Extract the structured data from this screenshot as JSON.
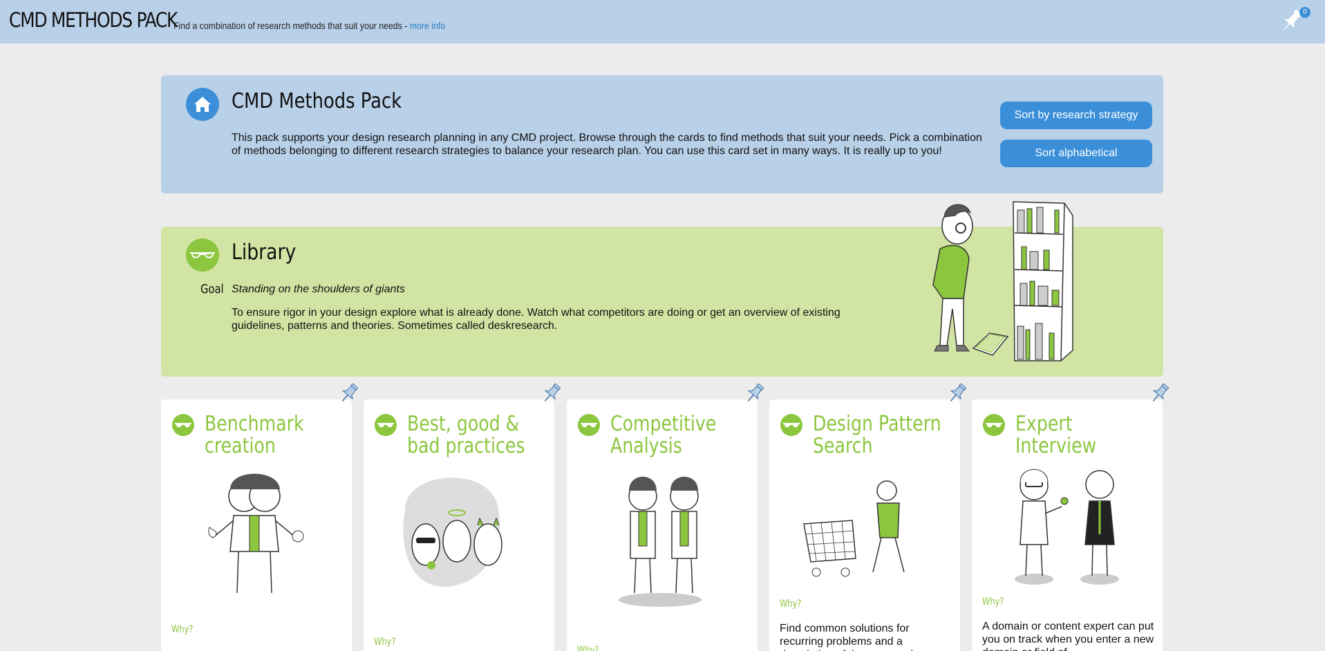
{
  "header": {
    "app_title": "CMD METHODS PACK",
    "tagline": "Find a combination of research methods that suit your needs - ",
    "more_info": "more info",
    "pin_count": "0"
  },
  "intro": {
    "title": "CMD Methods Pack",
    "text": "This pack supports your design research planning in any CMD project. Browse through the cards to find methods that suit your needs. Pick a combination of methods belonging to different research strategies to balance your research plan. You can use this card set in many ways. It is really up to you!",
    "sort_strategy": "Sort by research strategy",
    "sort_alpha": "Sort alphabetical"
  },
  "library": {
    "title": "Library",
    "goal_label": "Goal",
    "goal": "Standing on the shoulders of giants",
    "description": "To ensure rigor in your design explore what is already done. Watch what competitors are doing or get an overview of existing guidelines, patterns and theories. Sometimes called deskresearch."
  },
  "cards": [
    {
      "title": "Benchmark creation",
      "why": "Why?",
      "text": ""
    },
    {
      "title": "Best, good & bad practices",
      "why": "Why?",
      "text": ""
    },
    {
      "title": "Competitive Analysis",
      "why": "Why?",
      "text": ""
    },
    {
      "title": "Design Pattern Search",
      "why": "Why?",
      "text": "Find common solutions for recurring problems and a description of the proposed..."
    },
    {
      "title": "Expert Interview",
      "why": "Why?",
      "text": "A domain or content expert can put you on track when you enter a new domain or field of..."
    }
  ],
  "colors": {
    "header_bg": "#b8d0e8",
    "accent_blue": "#3b8fd9",
    "library_green": "#8cc63f",
    "library_bg": "#d2e4a3"
  }
}
